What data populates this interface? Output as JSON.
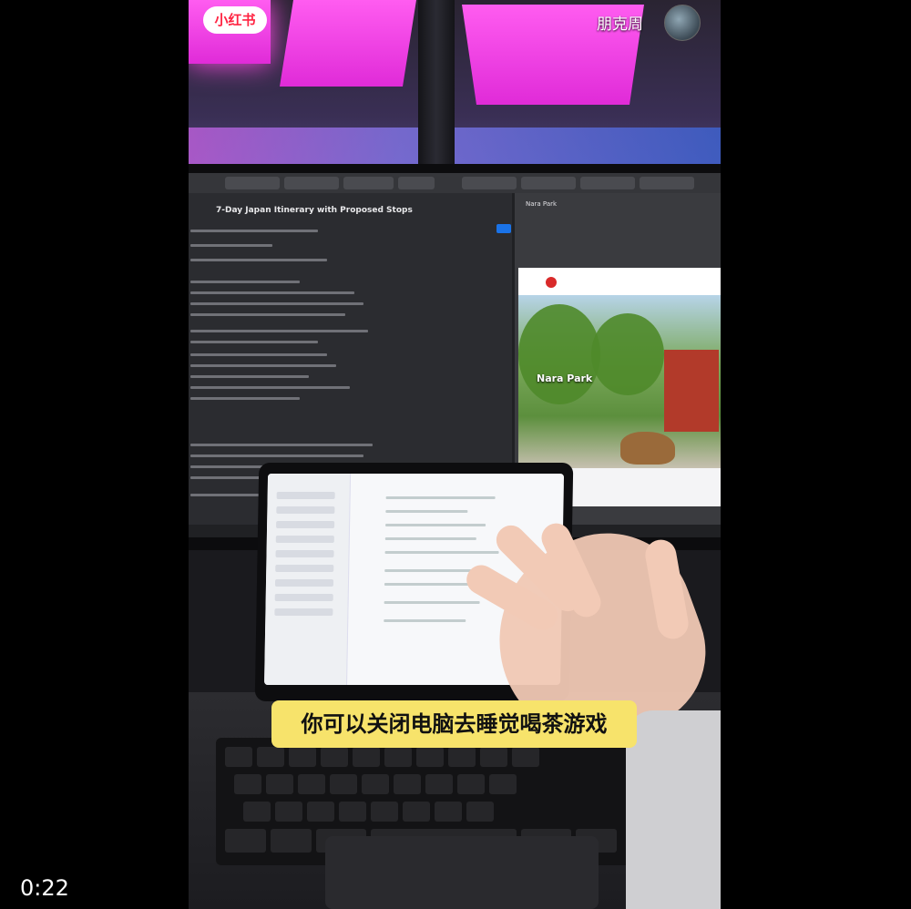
{
  "overlay": {
    "brand": "小红书",
    "author": "朋克周",
    "caption": "你可以关闭电脑去睡觉喝茶游戏",
    "timestamp": "0:22"
  },
  "monitor": {
    "chat_title": "7-Day Japan Itinerary with Proposed Stops",
    "side_title": "Nara Park",
    "hero_title": "Nara Park"
  },
  "colors": {
    "caption_bg": "#f7e36b",
    "brand_red": "#ff2442",
    "accent_pink": "#ff5cf0"
  }
}
